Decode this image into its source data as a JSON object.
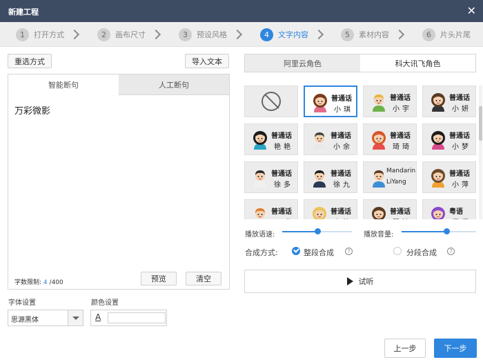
{
  "window": {
    "title": "新建工程",
    "close_glyph": "✕"
  },
  "steps": [
    {
      "num": "1",
      "label": "打开方式"
    },
    {
      "num": "2",
      "label": "画布尺寸"
    },
    {
      "num": "3",
      "label": "预设风格"
    },
    {
      "num": "4",
      "label": "文字内容"
    },
    {
      "num": "5",
      "label": "素材内容"
    },
    {
      "num": "6",
      "label": "片头片尾"
    }
  ],
  "left": {
    "reselect_label": "重选方式",
    "import_label": "导入文本",
    "tabs": [
      "智能断句",
      "人工断句"
    ],
    "text": "万彩微影",
    "count_label": "字数限制:",
    "count_current": "4",
    "count_max": "/400",
    "preview_label": "预览",
    "clear_label": "清空",
    "font_label": "字体设置",
    "font_value": "思源黑体",
    "color_label": "颜色设置",
    "color_glyph": "A"
  },
  "right": {
    "tabs": [
      "阿里云角色",
      "科大讯飞角色"
    ],
    "voices": [
      {
        "t1": "",
        "t2": "",
        "type": "none"
      },
      {
        "t1": "普通话",
        "t2": "小琪",
        "type": "girl",
        "hair": "#7a3b1b",
        "shirt": "#e26b8a",
        "selected": true
      },
      {
        "t1": "普通话",
        "t2": "小宇",
        "type": "boy",
        "hair": "#e9b43a",
        "shirt": "#6fb24a"
      },
      {
        "t1": "普通话",
        "t2": "小妍",
        "type": "woman",
        "hair": "#5a3a22",
        "shirt": "#333333"
      },
      {
        "t1": "普通话",
        "t2": "艳艳",
        "type": "woman",
        "hair": "#1c1c1c",
        "shirt": "#2aa4c4"
      },
      {
        "t1": "普通话",
        "t2": "小余",
        "type": "man",
        "hair": "#444444",
        "shirt": "#e9e9e9"
      },
      {
        "t1": "普通话",
        "t2": "琦琦",
        "type": "girl",
        "hair": "#d9562b",
        "shirt": "#e94d4d"
      },
      {
        "t1": "普通话",
        "t2": "小梦",
        "type": "girl",
        "hair": "#1c1c1c",
        "shirt": "#d94a8c"
      },
      {
        "t1": "普通话",
        "t2": "徐多",
        "type": "man",
        "hair": "#2c2c2c",
        "shirt": "#f0f0f0"
      },
      {
        "t1": "普通话",
        "t2": "徐九",
        "type": "man",
        "hair": "#1c1c1c",
        "shirt": "#2b3a55"
      },
      {
        "t1": "Mandarin",
        "t2": "LiYang",
        "type": "boy",
        "hair": "#5a3a22",
        "shirt": "#3e8ed6",
        "en": true
      },
      {
        "t1": "普通话",
        "t2": "小萍",
        "type": "girl",
        "hair": "#6b4a2a",
        "shirt": "#f0a030"
      },
      {
        "t1": "普通话",
        "t2": "子琪",
        "type": "boy",
        "hair": "#e07b2c",
        "shirt": "#4a90d9"
      },
      {
        "t1": "普通话",
        "t2": "小箐",
        "type": "girl",
        "hair": "#e9c45a",
        "shirt": "#f2a0b8"
      },
      {
        "t1": "普通话",
        "t2": "慧婆",
        "type": "woman",
        "hair": "#5a3a22",
        "shirt": "#c05a7a"
      },
      {
        "t1": "粤语",
        "t2": "樱樱",
        "type": "woman",
        "hair": "#8a4ac9",
        "shirt": "#d04a9a"
      }
    ],
    "speed_label": "播放语速:",
    "speed_value": 0.5,
    "volume_label": "播放音量:",
    "volume_value": 0.6,
    "synth_label": "合成方式:",
    "mode_whole": "整段合成",
    "mode_split": "分段合成",
    "help_glyph": "?",
    "listen_label": "试听"
  },
  "footer": {
    "prev_label": "上一步",
    "next_label": "下一步"
  },
  "colors": {
    "accent": "#2f86de",
    "titlebar": "#3d4b63"
  }
}
